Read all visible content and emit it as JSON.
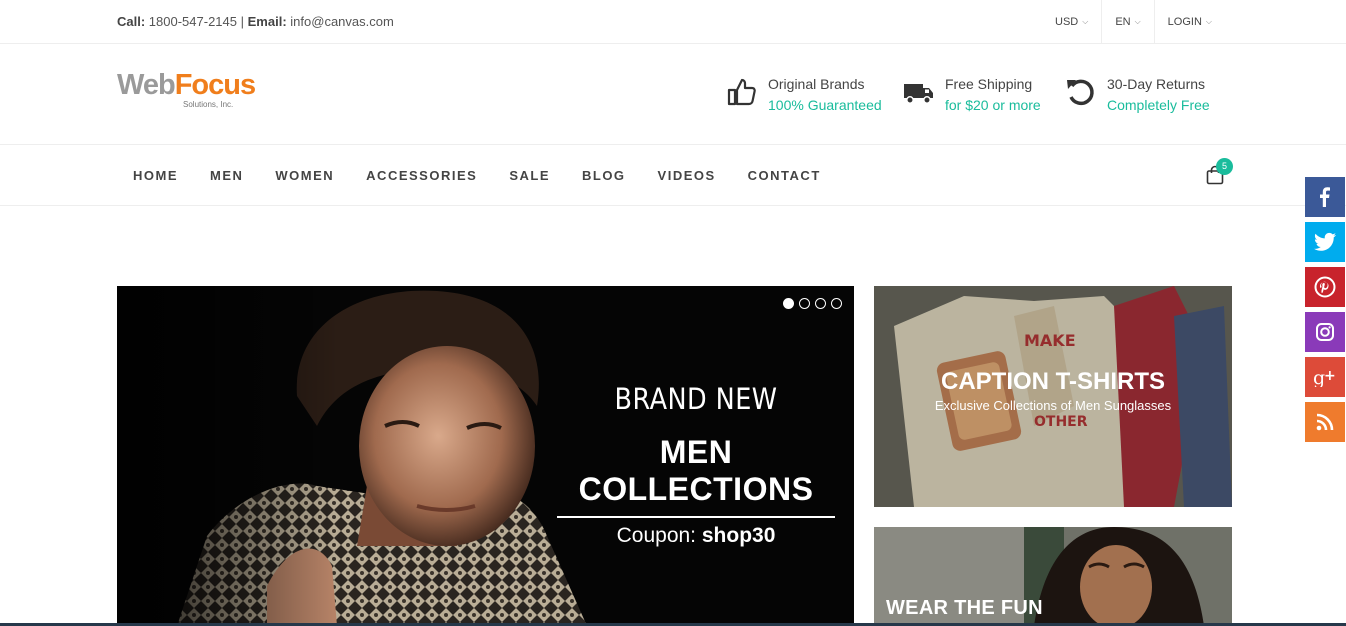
{
  "topbar": {
    "call_label": "Call:",
    "phone": "1800-547-2145",
    "separator": "|",
    "email_label": "Email:",
    "email": "info@canvas.com",
    "currency": "USD",
    "language": "EN",
    "login": "LOGIN"
  },
  "logo": {
    "web": "Web",
    "focus": "Focus",
    "sub": "Solutions, Inc."
  },
  "features": [
    {
      "icon": "thumbs-up-icon",
      "title": "Original Brands",
      "subtitle": "100% Guaranteed"
    },
    {
      "icon": "truck-icon",
      "title": "Free Shipping",
      "subtitle": "for $20 or more"
    },
    {
      "icon": "undo-icon",
      "title": "30-Day Returns",
      "subtitle": "Completely Free"
    }
  ],
  "nav": {
    "items": [
      "HOME",
      "MEN",
      "WOMEN",
      "ACCESSORIES",
      "SALE",
      "BLOG",
      "VIDEOS",
      "CONTACT"
    ],
    "cart_count": "5"
  },
  "slider": {
    "line1": "BRAND NEW",
    "line2": "MEN COLLECTIONS",
    "coupon_label": "Coupon:",
    "coupon_code": "shop30",
    "slide_count": 4,
    "active_slide": 1
  },
  "banners": {
    "first_title": "CAPTION T-SHIRTS",
    "first_subtitle": "Exclusive Collections of Men Sunglasses",
    "second_title": "WEAR THE FUN"
  },
  "social": [
    "facebook-icon",
    "twitter-icon",
    "pinterest-icon",
    "instagram-icon",
    "google-plus-icon",
    "rss-icon"
  ],
  "colors": {
    "accent": "#1abc9c",
    "logo_orange": "#f07e1c",
    "facebook": "#3b5998",
    "twitter": "#00acee",
    "pinterest": "#c8232c",
    "instagram": "#8a3ab9",
    "google_plus": "#dd4b39",
    "rss": "#ef7b2d"
  }
}
